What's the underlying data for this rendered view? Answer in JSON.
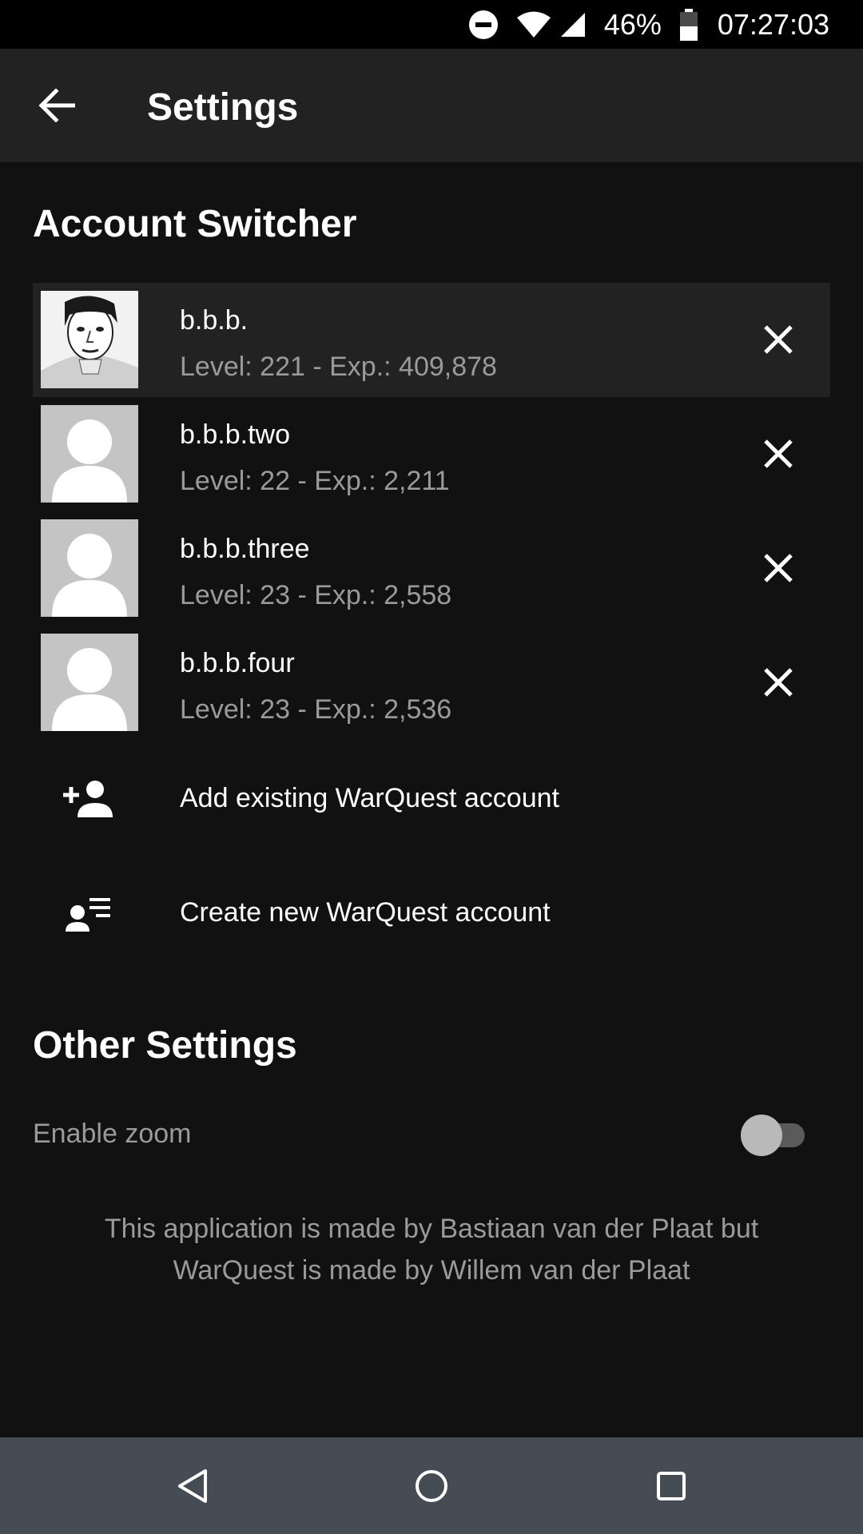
{
  "status_bar": {
    "battery_percent": "46%",
    "time": "07:27:03",
    "icons": [
      "do-not-disturb-icon",
      "wifi-icon",
      "cell-signal-icon",
      "battery-icon"
    ]
  },
  "app_bar": {
    "title": "Settings",
    "back_icon": "arrow-back-icon"
  },
  "account_switcher": {
    "title": "Account Switcher",
    "accounts": [
      {
        "name": "b.b.b.",
        "stats": "Level: 221 - Exp.: 409,878",
        "selected": true,
        "avatar": "photo"
      },
      {
        "name": "b.b.b.two",
        "stats": "Level: 22 - Exp.: 2,211",
        "selected": false,
        "avatar": "placeholder"
      },
      {
        "name": "b.b.b.three",
        "stats": "Level: 23 - Exp.: 2,558",
        "selected": false,
        "avatar": "placeholder"
      },
      {
        "name": "b.b.b.four",
        "stats": "Level: 23 - Exp.: 2,536",
        "selected": false,
        "avatar": "placeholder"
      }
    ],
    "remove_icon": "close-icon",
    "add_existing": {
      "label": "Add existing WarQuest account",
      "icon": "person-add-icon"
    },
    "create_new": {
      "label": "Create new WarQuest account",
      "icon": "person-list-icon"
    }
  },
  "other_settings": {
    "title": "Other Settings",
    "enable_zoom": {
      "label": "Enable zoom",
      "enabled": false
    }
  },
  "credits": "This application is made by Bastiaan van der Plaat but WarQuest is made by Willem van der Plaat",
  "nav_bar": {
    "buttons": [
      "back-triangle-icon",
      "home-circle-icon",
      "recents-square-icon"
    ]
  },
  "colors": {
    "background": "#111111",
    "app_bar": "#222222",
    "selected_row": "#222222",
    "secondary_text": "#9a9a9a",
    "nav_bar": "#464c53"
  }
}
